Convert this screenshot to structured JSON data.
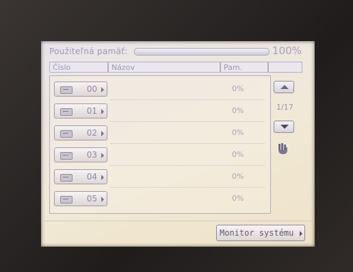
{
  "header": {
    "memory_label": "Použiteľná pamäť:",
    "memory_percent": "100%",
    "memory_fill_fraction": 1.0
  },
  "table": {
    "columns": [
      "Číslo",
      "Názov",
      "Pam."
    ],
    "rows": [
      {
        "number": "00",
        "name": "",
        "memory": "0%"
      },
      {
        "number": "01",
        "name": "",
        "memory": "0%"
      },
      {
        "number": "02",
        "name": "",
        "memory": "0%"
      },
      {
        "number": "03",
        "name": "",
        "memory": "0%"
      },
      {
        "number": "04",
        "name": "",
        "memory": "0%"
      },
      {
        "number": "05",
        "name": "",
        "memory": "0%"
      }
    ]
  },
  "pager": {
    "page_indicator": "1/17",
    "up_icon": "arrow-up-icon",
    "down_icon": "arrow-down-icon",
    "hand_icon": "hand-pointer-icon"
  },
  "footer": {
    "monitor_label": "Monitor systému"
  }
}
